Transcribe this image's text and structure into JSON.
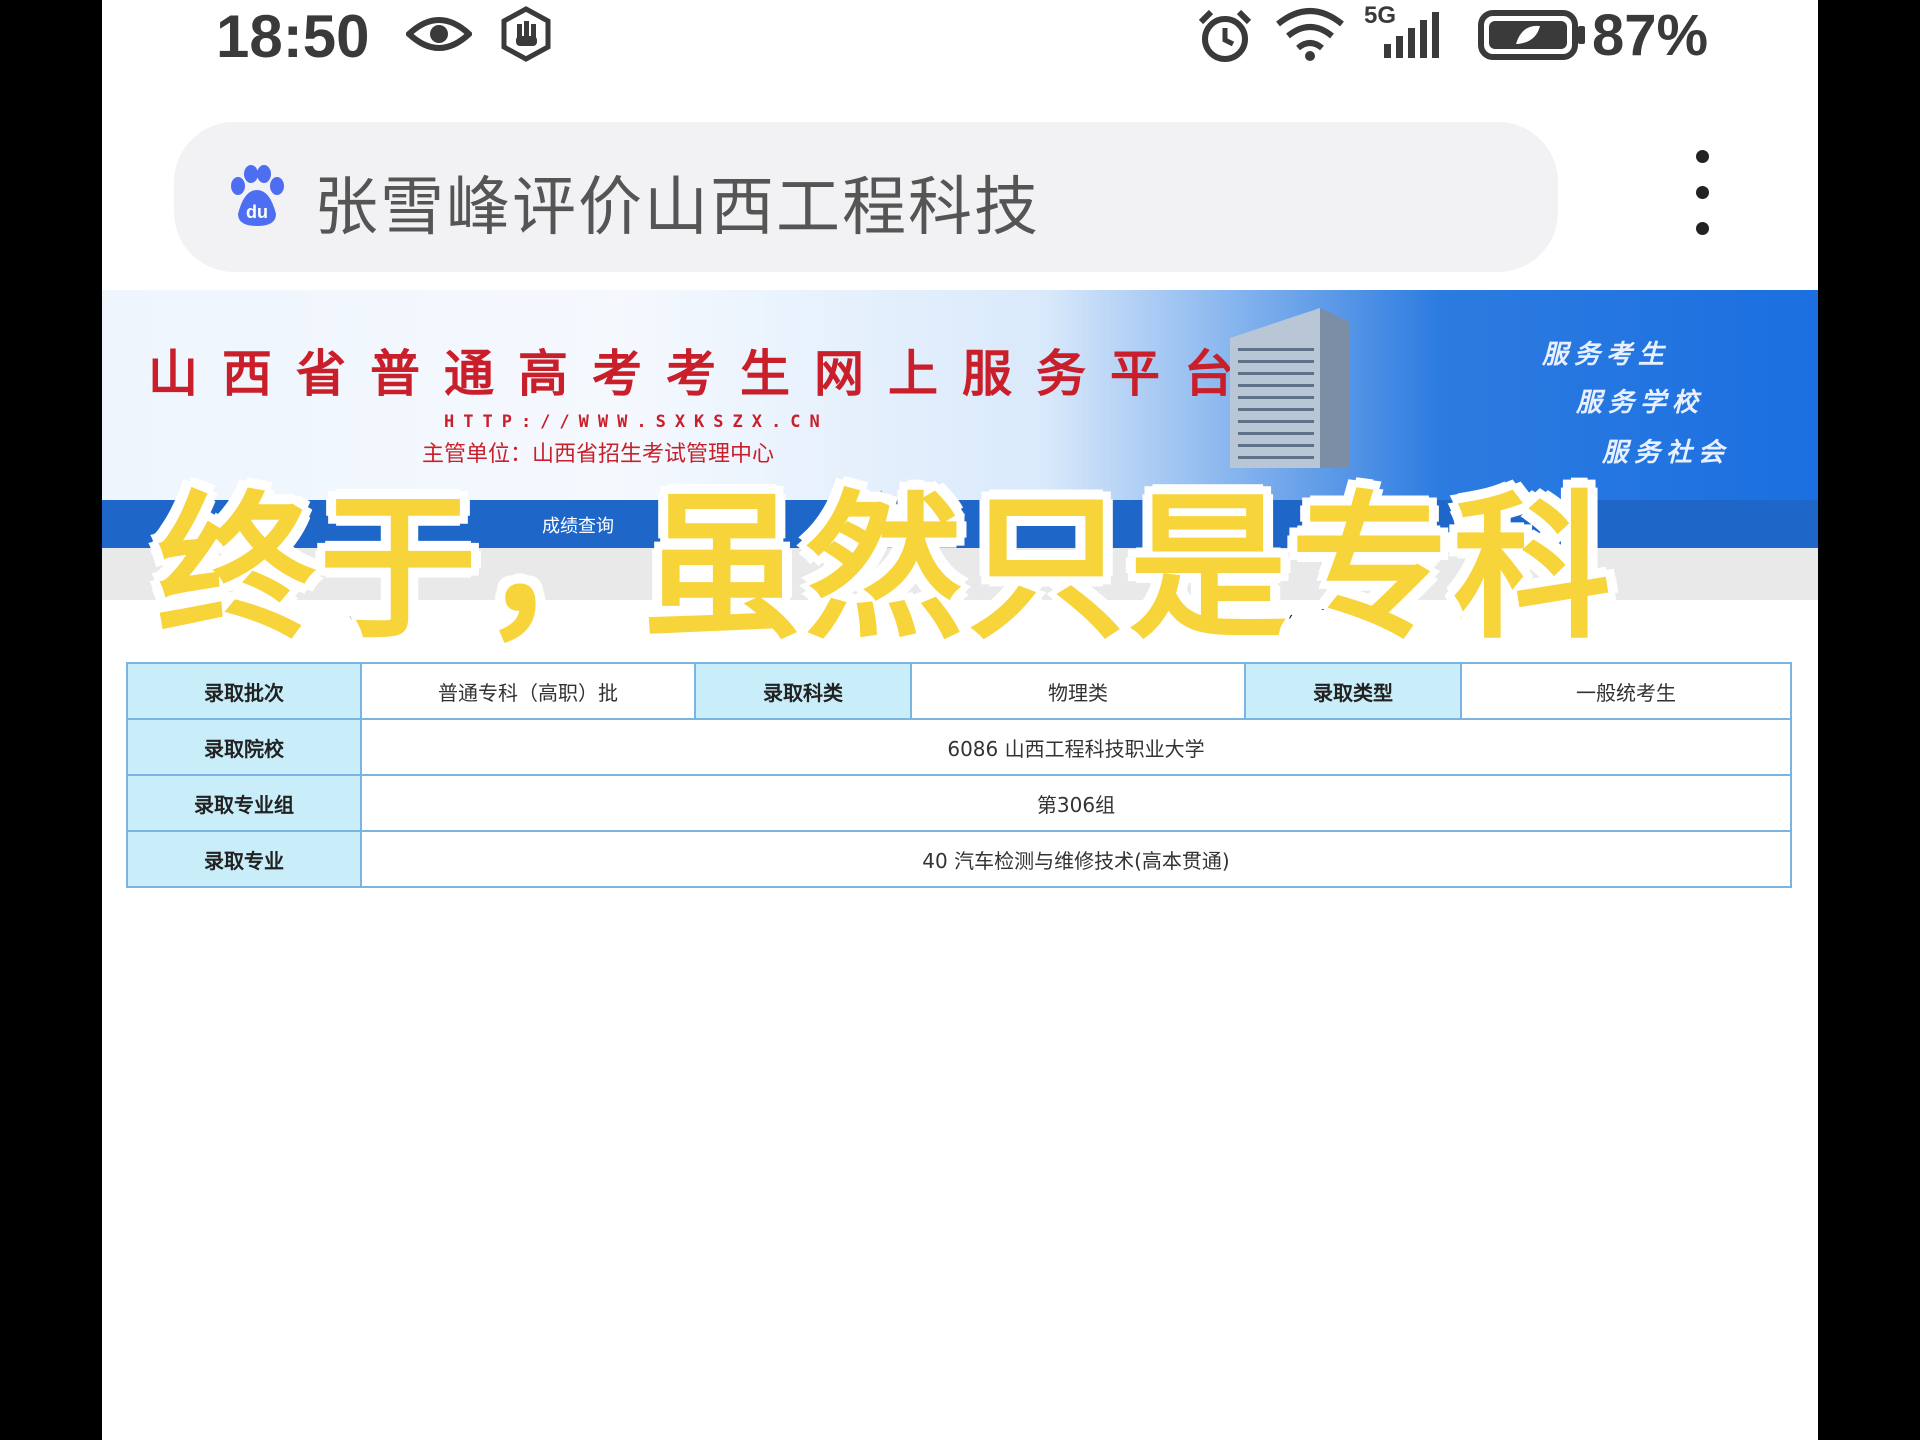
{
  "status_bar": {
    "time": "18:50",
    "network": "5G",
    "battery": "87%",
    "icons": [
      "eye-icon",
      "hand-icon",
      "alarm-icon",
      "wifi-icon",
      "signal-icon",
      "battery-icon"
    ]
  },
  "browser": {
    "url_text": "张雪峰评价山西工程科技",
    "icons": [
      "baidu-paw-icon",
      "more-vert-icon"
    ]
  },
  "site": {
    "title": "山西省普通高考考生网上服务平台",
    "url": "HTTP://WWW.SXKSZX.CN",
    "sponsor": "主管单位：山西省招生考试管理中心",
    "slogans": [
      "服务考生",
      "服务学校",
      "服务社会"
    ],
    "nav_item": "成绩查询"
  },
  "caption": "终于，虽然只是专科",
  "result": {
    "row1": {
      "batch_label": "录取批次",
      "batch_value": "普通专科（高职）批",
      "subject_label": "录取科类",
      "subject_value": "物理类",
      "type_label": "录取类型",
      "type_value": "一般统考生"
    },
    "school_label": "录取院校",
    "school_value": "6086 山西工程科技职业大学",
    "group_label": "录取专业组",
    "group_value": "第306组",
    "major_label": "录取专业",
    "major_value": "40 汽车检测与维修技术(高本贯通)"
  },
  "colors": {
    "caption_fill": "#f7d43a",
    "table_header_bg": "#c9eef9",
    "table_border": "#7bb4e0",
    "site_title": "#c91f2a",
    "nav_bar": "#1e67c9"
  }
}
